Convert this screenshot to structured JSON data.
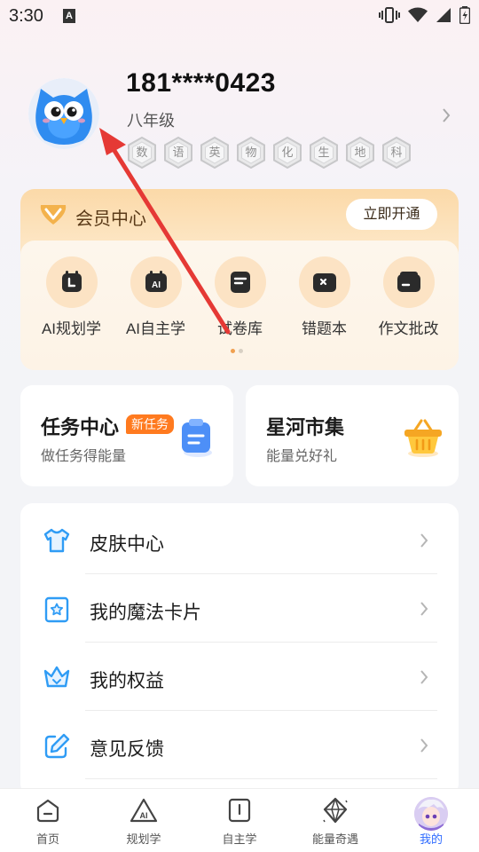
{
  "status_bar": {
    "time": "3:30",
    "notification_icon": "A"
  },
  "profile": {
    "phone": "181****0423",
    "grade": "八年级",
    "subjects": [
      "数",
      "语",
      "英",
      "物",
      "化",
      "生",
      "地",
      "科"
    ]
  },
  "member": {
    "title": "会员中心",
    "open_button": "立即开通",
    "tools": [
      {
        "label": "AI规划学",
        "icon": "planner-icon"
      },
      {
        "label": "AI自主学",
        "icon": "ai-study-icon"
      },
      {
        "label": "试卷库",
        "icon": "exam-library-icon"
      },
      {
        "label": "错题本",
        "icon": "mistake-book-icon"
      },
      {
        "label": "作文批改",
        "icon": "essay-correction-icon"
      }
    ],
    "page_indicator": {
      "count": 2,
      "active": 0
    }
  },
  "task_card": {
    "title": "任务中心",
    "tag": "新任务",
    "subtitle": "做任务得能量",
    "icon": "clipboard-icon"
  },
  "market_card": {
    "title": "星河市集",
    "subtitle": "能量兑好礼",
    "icon": "basket-icon"
  },
  "menu": [
    {
      "label": "皮肤中心",
      "icon": "tshirt-icon"
    },
    {
      "label": "我的魔法卡片",
      "icon": "star-card-icon"
    },
    {
      "label": "我的权益",
      "icon": "crown-icon"
    },
    {
      "label": "意见反馈",
      "icon": "edit-icon"
    }
  ],
  "bottom_nav": [
    {
      "label": "首页",
      "icon": "home-icon"
    },
    {
      "label": "规划学",
      "icon": "ai-plan-icon"
    },
    {
      "label": "自主学",
      "icon": "book-icon"
    },
    {
      "label": "能量奇遇",
      "icon": "crystal-icon"
    },
    {
      "label": "我的",
      "icon": "avatar-icon",
      "active": true
    }
  ],
  "colors": {
    "accent": "#2f6bff",
    "member_gold": "#fbd9a8",
    "tag_orange": "#ff7a1f",
    "annotation_arrow": "#e53935"
  }
}
